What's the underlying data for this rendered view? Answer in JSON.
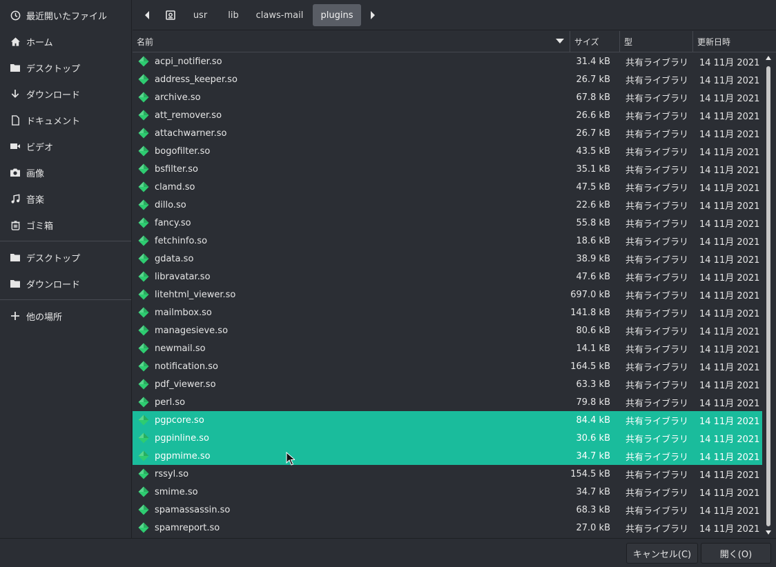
{
  "sidebar": {
    "items": [
      {
        "label": "最近開いたファイル",
        "icon": "recent-icon"
      },
      {
        "label": "ホーム",
        "icon": "home-icon"
      },
      {
        "label": "デスクトップ",
        "icon": "folder-icon"
      },
      {
        "label": "ダウンロード",
        "icon": "download-icon"
      },
      {
        "label": "ドキュメント",
        "icon": "document-icon"
      },
      {
        "label": "ビデオ",
        "icon": "video-icon"
      },
      {
        "label": "画像",
        "icon": "camera-icon"
      },
      {
        "label": "音楽",
        "icon": "music-icon"
      },
      {
        "label": "ゴミ箱",
        "icon": "trash-icon"
      }
    ],
    "bookmarks": [
      {
        "label": "デスクトップ",
        "icon": "folder-icon"
      },
      {
        "label": "ダウンロード",
        "icon": "folder-icon"
      }
    ],
    "other_locations": {
      "label": "他の場所",
      "icon": "plus-icon"
    }
  },
  "pathbar": {
    "segments": [
      "usr",
      "lib",
      "claws-mail",
      "plugins"
    ]
  },
  "table": {
    "columns": {
      "name": "名前",
      "size": "サイズ",
      "type": "型",
      "modified": "更新日時"
    },
    "rows": [
      {
        "name": "acpi_notifier.so",
        "size": "31.4 kB",
        "type": "共有ライブラリ",
        "modified": "14 11月 2021",
        "selected": false
      },
      {
        "name": "address_keeper.so",
        "size": "26.7 kB",
        "type": "共有ライブラリ",
        "modified": "14 11月 2021",
        "selected": false
      },
      {
        "name": "archive.so",
        "size": "67.8 kB",
        "type": "共有ライブラリ",
        "modified": "14 11月 2021",
        "selected": false
      },
      {
        "name": "att_remover.so",
        "size": "26.6 kB",
        "type": "共有ライブラリ",
        "modified": "14 11月 2021",
        "selected": false
      },
      {
        "name": "attachwarner.so",
        "size": "26.7 kB",
        "type": "共有ライブラリ",
        "modified": "14 11月 2021",
        "selected": false
      },
      {
        "name": "bogofilter.so",
        "size": "43.5 kB",
        "type": "共有ライブラリ",
        "modified": "14 11月 2021",
        "selected": false
      },
      {
        "name": "bsfilter.so",
        "size": "35.1 kB",
        "type": "共有ライブラリ",
        "modified": "14 11月 2021",
        "selected": false
      },
      {
        "name": "clamd.so",
        "size": "47.5 kB",
        "type": "共有ライブラリ",
        "modified": "14 11月 2021",
        "selected": false
      },
      {
        "name": "dillo.so",
        "size": "22.6 kB",
        "type": "共有ライブラリ",
        "modified": "14 11月 2021",
        "selected": false
      },
      {
        "name": "fancy.so",
        "size": "55.8 kB",
        "type": "共有ライブラリ",
        "modified": "14 11月 2021",
        "selected": false
      },
      {
        "name": "fetchinfo.so",
        "size": "18.6 kB",
        "type": "共有ライブラリ",
        "modified": "14 11月 2021",
        "selected": false
      },
      {
        "name": "gdata.so",
        "size": "38.9 kB",
        "type": "共有ライブラリ",
        "modified": "14 11月 2021",
        "selected": false
      },
      {
        "name": "libravatar.so",
        "size": "47.6 kB",
        "type": "共有ライブラリ",
        "modified": "14 11月 2021",
        "selected": false
      },
      {
        "name": "litehtml_viewer.so",
        "size": "697.0 kB",
        "type": "共有ライブラリ",
        "modified": "14 11月 2021",
        "selected": false
      },
      {
        "name": "mailmbox.so",
        "size": "141.8 kB",
        "type": "共有ライブラリ",
        "modified": "14 11月 2021",
        "selected": false
      },
      {
        "name": "managesieve.so",
        "size": "80.6 kB",
        "type": "共有ライブラリ",
        "modified": "14 11月 2021",
        "selected": false
      },
      {
        "name": "newmail.so",
        "size": "14.1 kB",
        "type": "共有ライブラリ",
        "modified": "14 11月 2021",
        "selected": false
      },
      {
        "name": "notification.so",
        "size": "164.5 kB",
        "type": "共有ライブラリ",
        "modified": "14 11月 2021",
        "selected": false
      },
      {
        "name": "pdf_viewer.so",
        "size": "63.3 kB",
        "type": "共有ライブラリ",
        "modified": "14 11月 2021",
        "selected": false
      },
      {
        "name": "perl.so",
        "size": "79.8 kB",
        "type": "共有ライブラリ",
        "modified": "14 11月 2021",
        "selected": false
      },
      {
        "name": "pgpcore.so",
        "size": "84.4 kB",
        "type": "共有ライブラリ",
        "modified": "14 11月 2021",
        "selected": true
      },
      {
        "name": "pgpinline.so",
        "size": "30.6 kB",
        "type": "共有ライブラリ",
        "modified": "14 11月 2021",
        "selected": true
      },
      {
        "name": "pgpmime.so",
        "size": "34.7 kB",
        "type": "共有ライブラリ",
        "modified": "14 11月 2021",
        "selected": true
      },
      {
        "name": "rssyl.so",
        "size": "154.5 kB",
        "type": "共有ライブラリ",
        "modified": "14 11月 2021",
        "selected": false
      },
      {
        "name": "smime.so",
        "size": "34.7 kB",
        "type": "共有ライブラリ",
        "modified": "14 11月 2021",
        "selected": false
      },
      {
        "name": "spamassassin.so",
        "size": "68.3 kB",
        "type": "共有ライブラリ",
        "modified": "14 11月 2021",
        "selected": false
      },
      {
        "name": "spamreport.so",
        "size": "27.0 kB",
        "type": "共有ライブラリ",
        "modified": "14 11月 2021",
        "selected": false
      }
    ]
  },
  "buttons": {
    "cancel": "キャンセル(C)",
    "open": "開く(O)"
  },
  "colors": {
    "background": "#2b2e34",
    "selection": "#1abc9c",
    "file_icon": "#2ecc71"
  }
}
